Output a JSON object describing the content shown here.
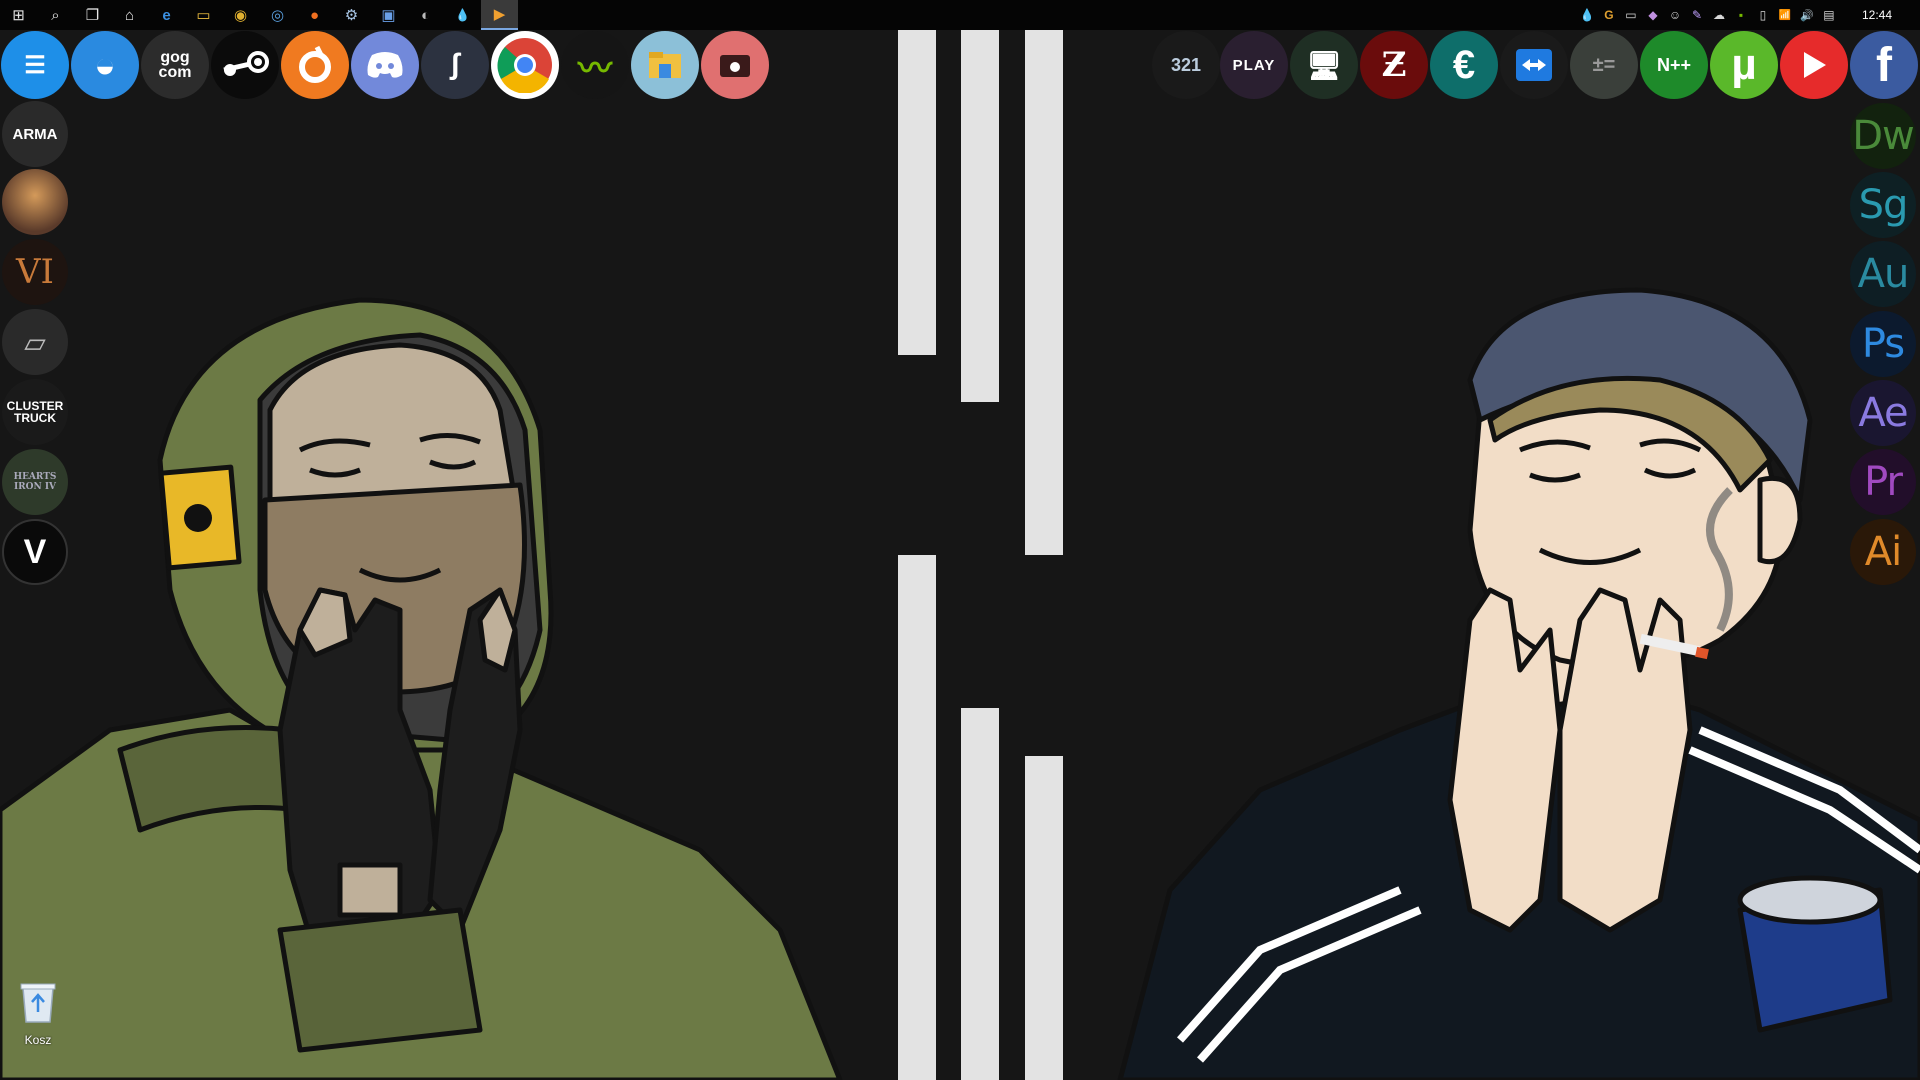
{
  "taskbar": {
    "clock": "12:44",
    "buttons": [
      {
        "name": "start-button",
        "glyph": "⊞"
      },
      {
        "name": "search-button",
        "glyph": "⌕"
      },
      {
        "name": "task-view-button",
        "glyph": "❐"
      },
      {
        "name": "store-button",
        "glyph": "⌂"
      },
      {
        "name": "edge-button",
        "glyph": "e"
      },
      {
        "name": "file-explorer-button",
        "glyph": "▭"
      },
      {
        "name": "chrome-button",
        "glyph": "◉"
      },
      {
        "name": "uplay-button",
        "glyph": "◎"
      },
      {
        "name": "origin-button",
        "glyph": "●"
      },
      {
        "name": "steam-button",
        "glyph": "⚙"
      },
      {
        "name": "remote-button",
        "glyph": "▣"
      },
      {
        "name": "app-button",
        "glyph": "◐"
      },
      {
        "name": "drop-button",
        "glyph": "💧"
      },
      {
        "name": "media-player-button",
        "glyph": "▶"
      }
    ],
    "tray": [
      "💧",
      "G",
      "▭",
      "◆",
      "☺",
      "✎",
      "☁",
      "▪",
      "▯",
      "📶",
      "🔊",
      "▤"
    ]
  },
  "top_dock": {
    "gog_label": "gog\ncom",
    "play_label": "PLAY",
    "counter_label": "321"
  },
  "adobe_apps": [
    {
      "label": "Dw",
      "color": "#4a8a3a"
    },
    {
      "label": "Sg",
      "color": "#2a9ab0"
    },
    {
      "label": "Au",
      "color": "#2a8aa0"
    },
    {
      "label": "Ps",
      "color": "#2e8ae0"
    },
    {
      "label": "Ae",
      "color": "#8a7ae0"
    },
    {
      "label": "Pr",
      "color": "#a04ac0"
    },
    {
      "label": "Ai",
      "color": "#e08a2a"
    }
  ],
  "left_games": {
    "arma_label": "ARMA",
    "civ_label": "VI",
    "clustertruck_label": "CLUSTER\nTRUCK",
    "hoi_label": "HEARTS\nIRON IV",
    "gta_label": "V"
  },
  "recycle_bin": {
    "label": "Kosz"
  },
  "colors": {
    "background": "#151515",
    "stripe": "#e3e3e3",
    "taskbar": "#050505"
  }
}
